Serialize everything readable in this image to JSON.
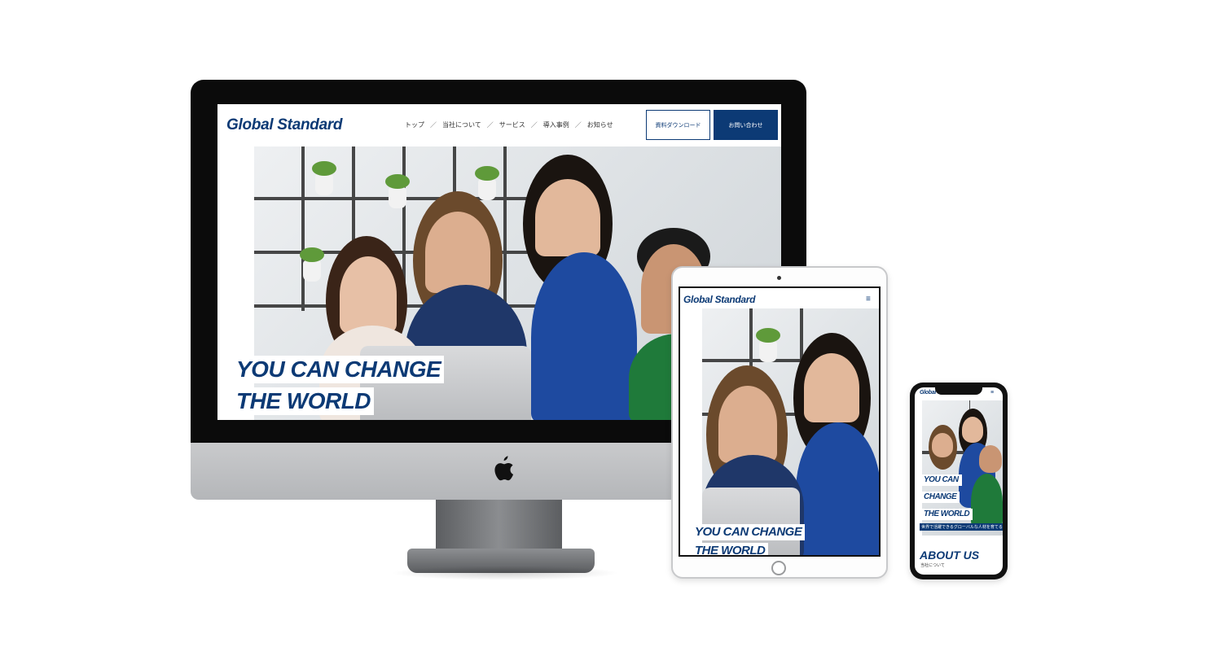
{
  "site": {
    "logo": "Global Standard",
    "nav": {
      "items": [
        "トップ",
        "当社について",
        "サービス",
        "導入事例",
        "お知らせ"
      ],
      "separator": "／"
    },
    "buttons": {
      "download": "資料ダウンロード",
      "contact": "お問い合わせ"
    },
    "hero": {
      "line1": "YOU CAN CHANGE",
      "line2": "THE WORLD"
    },
    "mobile_hero": {
      "line1": "YOU CAN",
      "line2": "CHANGE",
      "line3": "THE WORLD",
      "tagline": "世界で活躍できるグローバルな人材を育てる"
    },
    "about": {
      "title": "ABOUT US",
      "subtitle": "当社について"
    },
    "menu_icon": "≡"
  },
  "icons": {
    "apple": "apple-logo-icon",
    "menu": "hamburger-menu-icon"
  },
  "colors": {
    "brand": "#0c3a75",
    "background": "#ffffff",
    "device_bezel": "#0b0b0b",
    "device_silver": "#b4b6b9"
  }
}
